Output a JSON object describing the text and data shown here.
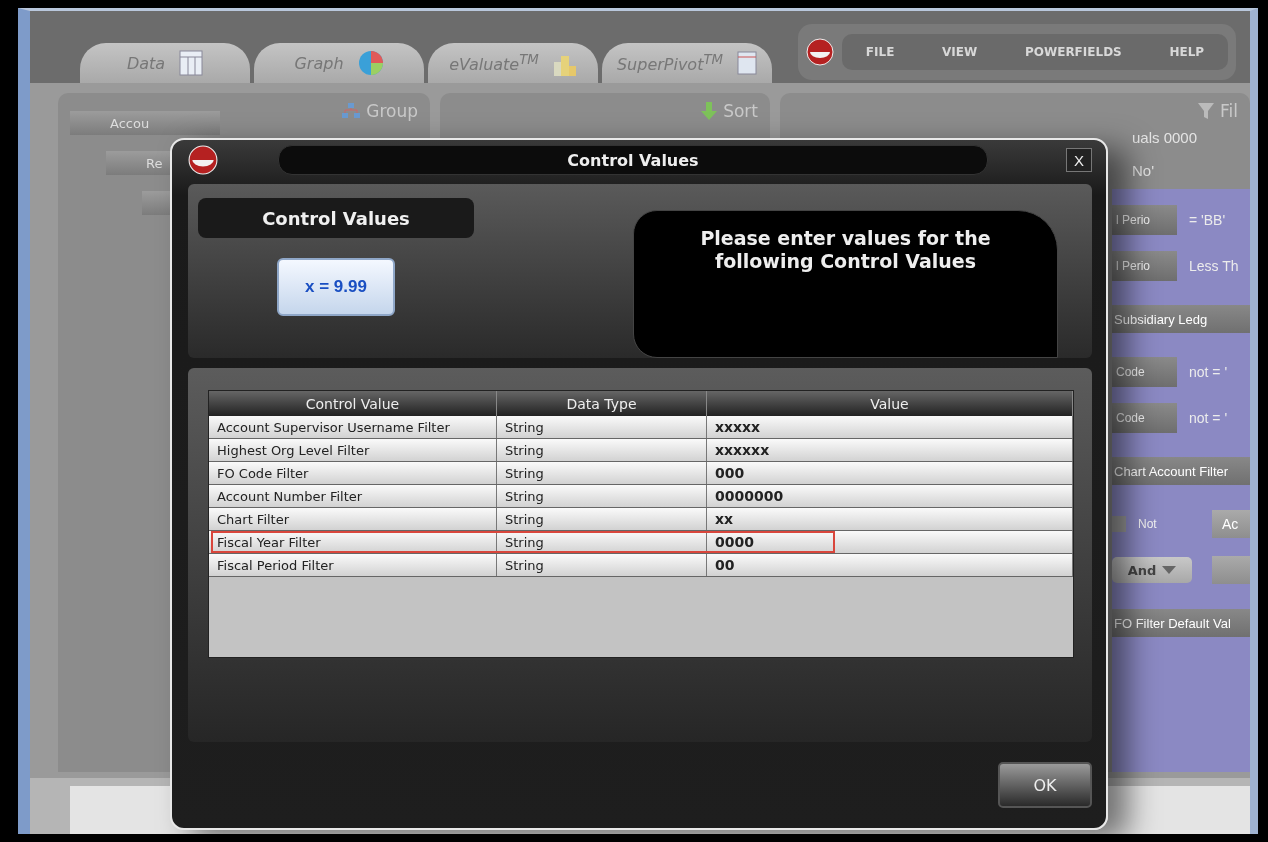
{
  "app": {
    "tabs": [
      {
        "label": "Data"
      },
      {
        "label": "Graph"
      },
      {
        "label": "eValuate$^{TM}$"
      },
      {
        "label": "SuperPivot$^{TM}$"
      }
    ],
    "menu": [
      "FILE",
      "VIEW",
      "POWERFIELDS",
      "HELP"
    ],
    "group_panel": {
      "title": "Group",
      "items": [
        "Accou",
        "Re"
      ]
    },
    "sort_panel": {
      "title": "Sort"
    },
    "filter_panel": {
      "title": "Fil",
      "equals": "uals 0000",
      "note": "No'",
      "rows": [
        {
          "kind": "condition",
          "field": "l Perio",
          "operator": "= 'BB'"
        },
        {
          "kind": "condition",
          "field": "l Perio",
          "operator": "Less Th"
        },
        {
          "kind": "header",
          "label": "Subsidiary Ledg"
        },
        {
          "kind": "condition",
          "field": "Code",
          "operator": "not = '"
        },
        {
          "kind": "condition",
          "field": "Code",
          "operator": "not = '"
        },
        {
          "kind": "header",
          "label": "Chart Account Filter"
        },
        {
          "kind": "checkbox",
          "label": "Not",
          "checked": false,
          "button": "Ac"
        },
        {
          "kind": "dropdown",
          "label": "And"
        },
        {
          "kind": "header",
          "label": "FO Filter Default Val"
        }
      ]
    }
  },
  "dialog": {
    "title": "Control Values",
    "close": "X",
    "badge": "Control Values",
    "icon_text": "x = 9.99",
    "prompt": "Please enter values for the following Control Values",
    "columns": [
      "Control Value",
      "Data Type",
      "Value"
    ],
    "rows": [
      {
        "name": "Account Supervisor Username Filter",
        "type": "String",
        "value": "xxxxx",
        "highlighted": false
      },
      {
        "name": "Highest Org Level Filter",
        "type": "String",
        "value": "xxxxxx",
        "highlighted": false
      },
      {
        "name": "FO Code Filter",
        "type": "String",
        "value": "000",
        "highlighted": false
      },
      {
        "name": "Account Number Filter",
        "type": "String",
        "value": "0000000",
        "highlighted": false
      },
      {
        "name": "Chart Filter",
        "type": "String",
        "value": "xx",
        "highlighted": false
      },
      {
        "name": "Fiscal Year Filter",
        "type": "String",
        "value": "0000",
        "highlighted": true
      },
      {
        "name": "Fiscal Period Filter",
        "type": "String",
        "value": "00",
        "highlighted": false
      }
    ],
    "ok": "OK"
  }
}
